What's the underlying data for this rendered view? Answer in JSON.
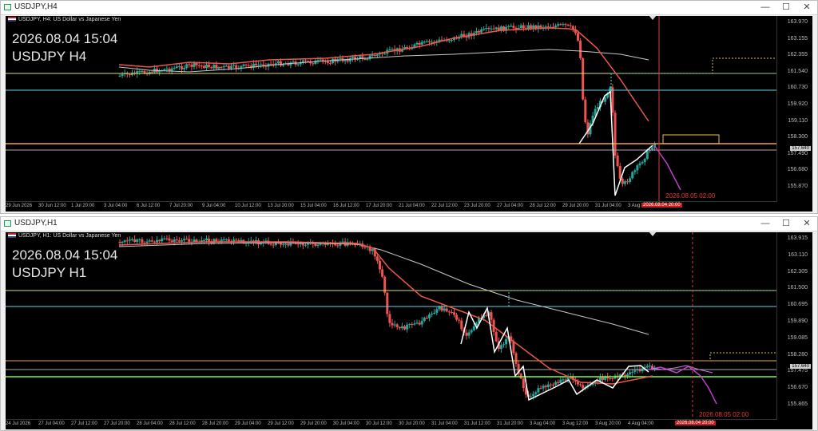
{
  "windows": [
    {
      "title": "USDJPY,H4",
      "symbol_info": "USDJPY, H4:  US Dollar vs Japanese Yen",
      "overlay_time": "2026.08.04 15:04",
      "overlay_symbol": "USDJPY H4",
      "price_ticks": [
        "163.970",
        "163.155",
        "162.355",
        "161.540",
        "160.730",
        "159.920",
        "159.110",
        "158.300",
        "157.490",
        "156.680",
        "155.870"
      ],
      "current_price": "157.640",
      "time_ticks": [
        "29 Jun 2026",
        "30 Jun 12:00",
        "1 Jul 20:00",
        "3 Jul 04:00",
        "6 Jul 12:00",
        "7 Jul 20:00",
        "9 Jul 04:00",
        "10 Jul 12:00",
        "13 Jul 20:00",
        "15 Jul 04:00",
        "16 Jul 12:00",
        "17 Jul 20:00",
        "21 Jul 04:00",
        "22 Jul 12:00",
        "23 Jul 20:00",
        "27 Jul 04:00",
        "28 Jul 12:00",
        "29 Jul 20:00",
        "31 Jul 04:00",
        "3 Aug"
      ],
      "time_marker": "2026.08.04 20:00",
      "end_label": "2026.08.05 02:00"
    },
    {
      "title": "USDJPY,H1",
      "symbol_info": "USDJPY, H1:  US Dollar vs Japanese Yen",
      "overlay_time": "2026.08.04 15:04",
      "overlay_symbol": "USDJPY H1",
      "price_ticks": [
        "163.915",
        "163.110",
        "162.305",
        "161.500",
        "160.695",
        "159.890",
        "159.085",
        "158.280",
        "157.475",
        "156.670",
        "155.865"
      ],
      "current_price": "157.640",
      "time_ticks": [
        "24 Jul 2026",
        "27 Jul 04:00",
        "27 Jul 12:00",
        "27 Jul 20:00",
        "28 Jul 04:00",
        "28 Jul 12:00",
        "28 Jul 20:00",
        "29 Jul 04:00",
        "29 Jul 12:00",
        "29 Jul 20:00",
        "30 Jul 04:00",
        "30 Jul 12:00",
        "30 Jul 20:00",
        "31 Jul 04:00",
        "31 Jul 12:00",
        "31 Jul 20:00",
        "3 Aug 04:00",
        "3 Aug 12:00",
        "3 Aug 20:00",
        "4 Aug 04:00"
      ],
      "time_marker": "2026.08.04 20:00",
      "end_label": "2026.08.05 02:00"
    }
  ],
  "colors": {
    "bull": "#26a69a",
    "bear": "#ef5350",
    "ma_fast": "#e8584a",
    "ma_slow": "#c8c8c8",
    "zigzag": "#ffffff",
    "projection": "#c13fd0",
    "hline_orange": "#f0a040",
    "hline_yellow": "#d8e06a",
    "hline_cyan": "#5fd3e6",
    "hline_green": "#7cfc3a",
    "vline_red": "#e03a3a"
  },
  "controls": {
    "minimize": "—",
    "maximize": "☐",
    "close": "✕"
  }
}
